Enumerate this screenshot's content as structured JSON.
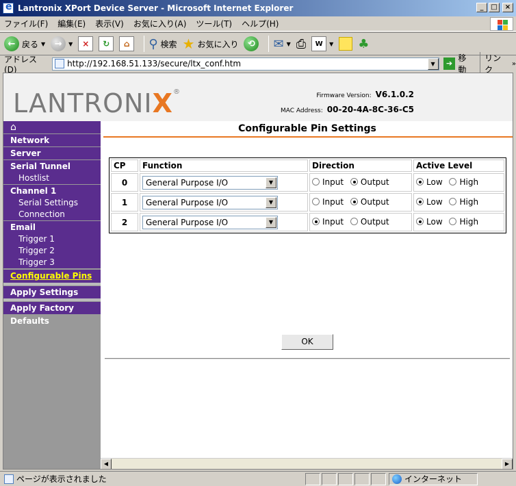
{
  "window": {
    "title": "Lantronix XPort Device Server - Microsoft Internet Explorer"
  },
  "menu": [
    "ファイル(F)",
    "編集(E)",
    "表示(V)",
    "お気に入り(A)",
    "ツール(T)",
    "ヘルプ(H)"
  ],
  "toolbar": {
    "back": "戻る",
    "search": "検索",
    "favorites": "お気に入り"
  },
  "address": {
    "label": "アドレス(D)",
    "url": "http://192.168.51.133/secure/ltx_conf.htm",
    "go": "移動",
    "links": "リンク"
  },
  "header": {
    "logo_main": "LANTRONI",
    "logo_x": "X",
    "logo_reg": "®",
    "firmware_label": "Firmware Version:",
    "firmware_value": "V6.1.0.2",
    "mac_label": "MAC Address:",
    "mac_value": "00-20-4A-8C-36-C5"
  },
  "sidebar": {
    "home": "⌂",
    "items": [
      {
        "label": "Network"
      },
      {
        "label": "Server"
      },
      {
        "label": "Serial Tunnel"
      },
      {
        "label": "Hostlist"
      },
      {
        "label": "Channel 1"
      },
      {
        "label": "Serial Settings"
      },
      {
        "label": "Connection"
      },
      {
        "label": "Email"
      },
      {
        "label": "Trigger 1"
      },
      {
        "label": "Trigger 2"
      },
      {
        "label": "Trigger 3"
      },
      {
        "label": "Configurable Pins"
      },
      {
        "label": "Apply Settings"
      },
      {
        "label": "Apply Factory Defaults"
      }
    ]
  },
  "page": {
    "title": "Configurable Pin Settings",
    "columns": [
      "CP",
      "Function",
      "Direction",
      "Active Level"
    ],
    "rows": [
      {
        "cp": "0",
        "function": "General Purpose I/O",
        "direction": "Output",
        "level": "Low"
      },
      {
        "cp": "1",
        "function": "General Purpose I/O",
        "direction": "Output",
        "level": "Low"
      },
      {
        "cp": "2",
        "function": "General Purpose I/O",
        "direction": "Input",
        "level": "Low"
      }
    ],
    "dir_input": "Input",
    "dir_output": "Output",
    "lvl_low": "Low",
    "lvl_high": "High",
    "ok": "OK"
  },
  "status": {
    "text": "ページが表示されました",
    "zone": "インターネット"
  }
}
